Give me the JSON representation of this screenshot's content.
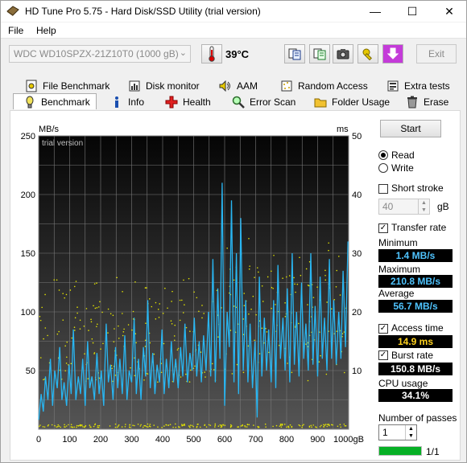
{
  "window": {
    "title": "HD Tune Pro 5.75 - Hard Disk/SSD Utility (trial version)",
    "controls": {
      "minimize": "—",
      "maximize": "☐",
      "close": "✕"
    }
  },
  "menu": {
    "file": "File",
    "help": "Help"
  },
  "toolbar": {
    "drive": "WDC WD10SPZX-21Z10T0 (1000 gB)",
    "temperature": "39°C",
    "exit": "Exit"
  },
  "tabs_row1": [
    {
      "label": "File Benchmark",
      "icon": "file-benchmark-icon"
    },
    {
      "label": "Disk monitor",
      "icon": "disk-monitor-icon"
    },
    {
      "label": "AAM",
      "icon": "speaker-icon"
    },
    {
      "label": "Random Access",
      "icon": "random-access-icon"
    },
    {
      "label": "Extra tests",
      "icon": "extra-tests-icon"
    }
  ],
  "tabs_row2": [
    {
      "label": "Benchmark",
      "icon": "benchmark-icon",
      "active": true
    },
    {
      "label": "Info",
      "icon": "info-icon"
    },
    {
      "label": "Health",
      "icon": "health-cross-icon"
    },
    {
      "label": "Error Scan",
      "icon": "magnifier-icon"
    },
    {
      "label": "Folder Usage",
      "icon": "folder-icon"
    },
    {
      "label": "Erase",
      "icon": "trash-icon"
    }
  ],
  "side": {
    "start": "Start",
    "read": "Read",
    "write": "Write",
    "short_stroke": "Short stroke",
    "stroke_value": "40",
    "stroke_unit": "gB",
    "transfer_rate": "Transfer rate",
    "minimum_label": "Minimum",
    "minimum": "1.4 MB/s",
    "maximum_label": "Maximum",
    "maximum": "210.8 MB/s",
    "average_label": "Average",
    "average": "56.7 MB/s",
    "access_time": "Access time",
    "access_value": "14.9 ms",
    "burst_rate": "Burst rate",
    "burst_value": "150.8 MB/s",
    "cpu_label": "CPU usage",
    "cpu_value": "34.1%",
    "passes_label": "Number of passes",
    "passes_value": "1",
    "progress_text": "1/1",
    "progress_fraction": 1.0
  },
  "colors": {
    "transfer_line": "#29b6f2",
    "access_dots": "#e5e500",
    "value_text": "#4fc4ff",
    "progress": "#06b025"
  },
  "chart_data": {
    "type": "line",
    "watermark": "trial version",
    "left_unit": "MB/s",
    "right_unit": "ms",
    "left_ticks": [
      "250",
      "200",
      "150",
      "100",
      "50"
    ],
    "right_ticks": [
      "50",
      "40",
      "30",
      "20",
      "10"
    ],
    "x_ticks": [
      "0",
      "100",
      "200",
      "300",
      "400",
      "500",
      "600",
      "700",
      "800",
      "900",
      "1000gB"
    ],
    "ylim_left": [
      0,
      250
    ],
    "ylim_right": [
      0,
      50
    ],
    "xlim": [
      0,
      1000
    ],
    "grid": true,
    "series": [
      {
        "name": "Transfer rate",
        "axis": "left",
        "x": [
          0,
          8,
          15,
          22,
          30,
          38,
          45,
          52,
          60,
          68,
          75,
          82,
          90,
          98,
          105,
          112,
          120,
          128,
          135,
          142,
          150,
          158,
          165,
          172,
          180,
          188,
          195,
          202,
          210,
          218,
          225,
          232,
          240,
          248,
          255,
          262,
          270,
          278,
          285,
          292,
          300,
          308,
          315,
          322,
          330,
          338,
          345,
          352,
          360,
          368,
          375,
          382,
          390,
          398,
          405,
          412,
          420,
          428,
          435,
          442,
          450,
          458,
          465,
          472,
          480,
          488,
          495,
          502,
          510,
          518,
          525,
          532,
          540,
          548,
          555,
          562,
          570,
          578,
          585,
          592,
          600,
          608,
          615,
          622,
          630,
          638,
          645,
          652,
          660,
          668,
          675,
          682,
          690,
          698,
          705,
          712,
          720,
          728,
          735,
          742,
          750,
          758,
          765,
          772,
          780,
          788,
          795,
          802,
          810,
          818,
          825,
          832,
          840,
          848,
          855,
          862,
          870,
          878,
          885,
          892,
          900,
          908,
          915,
          922,
          930,
          938,
          945,
          952,
          960,
          968,
          975,
          982,
          990,
          998
        ],
        "y": [
          8,
          30,
          15,
          45,
          25,
          60,
          20,
          50,
          35,
          70,
          25,
          40,
          20,
          55,
          30,
          85,
          25,
          45,
          30,
          60,
          20,
          75,
          35,
          45,
          25,
          65,
          30,
          50,
          20,
          90,
          40,
          55,
          25,
          70,
          35,
          60,
          30,
          80,
          25,
          50,
          40,
          95,
          30,
          60,
          25,
          70,
          45,
          110,
          35,
          65,
          30,
          55,
          40,
          85,
          30,
          60,
          35,
          75,
          40,
          60,
          35,
          70,
          45,
          90,
          40,
          65,
          50,
          95,
          45,
          75,
          40,
          80,
          50,
          100,
          45,
          145,
          40,
          120,
          60,
          210,
          20,
          100,
          70,
          195,
          40,
          150,
          30,
          180,
          50,
          110,
          40,
          90,
          35,
          75,
          10,
          130,
          45,
          95,
          50,
          85,
          40,
          110,
          35,
          140,
          60,
          95,
          50,
          120,
          40,
          150,
          55,
          100,
          45,
          125,
          60,
          90,
          50,
          150,
          55,
          105,
          45,
          130,
          60,
          95,
          50,
          145,
          60,
          110,
          55,
          100,
          60,
          135,
          70,
          160
        ]
      }
    ]
  }
}
